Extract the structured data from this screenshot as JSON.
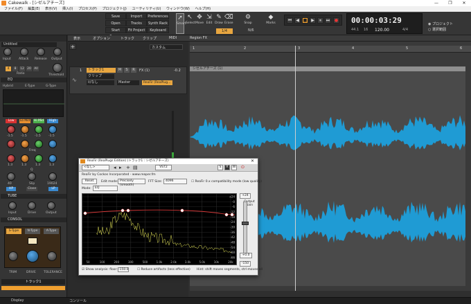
{
  "window": {
    "title": "Cakewalk - [シゼルアチーズ]",
    "controls": [
      "—",
      "❐",
      "✕"
    ]
  },
  "menu": [
    "ファイル(F)",
    "編集(E)",
    "表示(V)",
    "挿入(I)",
    "プロセス(P)",
    "プロジェクト(J)",
    "ユーティリティ(U)",
    "ウィンドウ(W)",
    "ヘルプ(H)"
  ],
  "control_bar": {
    "workspace_buttons": [
      [
        "Save",
        "Import",
        "Preferences"
      ],
      [
        "Open",
        "Tracks",
        "Synth Rack"
      ],
      [
        "Start Screen",
        "Fit Project",
        "Keyboard"
      ]
    ],
    "tools": [
      "Smart",
      "Select",
      "Move",
      "Edit",
      "Draw",
      "Erase"
    ],
    "snap": "Snap",
    "snap_value": "1/4",
    "nudge": "N/6",
    "marks": "Marks",
    "time": "00:00:03:29",
    "bpm": "120.00",
    "meter": "4/4",
    "sample_rate": "44.1",
    "bits": "16",
    "project_radio": "プロジェクト",
    "selection_radio": "選択範囲"
  },
  "inspector": {
    "track_label": "Untitled",
    "knob_labels": [
      "Input",
      "Attack",
      "Release",
      "Output"
    ],
    "ratio_values": [
      "4",
      "8",
      "12",
      "20",
      "All"
    ],
    "ratio_label": "Ratio",
    "threshold_label": "Threshold",
    "eq_label": "EQ",
    "eq_modes": [
      "Hybrid",
      "E-Type",
      "G-Type"
    ],
    "eq_bands": [
      "Low",
      "Lo Mid",
      "Hi Mid",
      "High"
    ],
    "gain_values": [
      "-1.5",
      "-1.5",
      "-1.5",
      "-1.5"
    ],
    "freq_label": "Freq",
    "q_label": "Q",
    "q_values": [
      "1.3",
      "1.3",
      "1.3",
      "1.3"
    ],
    "filter_labels": [
      "HP",
      "Slip",
      "LP"
    ],
    "hp_value": "40",
    "lp_value": "19024",
    "close_label": "Close",
    "tube_label": "TUBE",
    "tube_knobs": [
      "Input",
      "Drive",
      "Output"
    ],
    "console_label": "CONSOL",
    "console_modes": [
      "S-Type",
      "N-Type",
      "A-Type"
    ],
    "bottom_knobs": [
      "TRIM",
      "DRIVE",
      "TOLERANCE"
    ],
    "track_name": "トラック1",
    "display_tab": "Display"
  },
  "tabs": [
    "表示",
    "オプション",
    "トラック",
    "クリップ",
    "MIDI",
    "Region FX"
  ],
  "custom_select": "カスタム",
  "track": {
    "number": "1",
    "name": "トラック1",
    "clip_label": "クリップ",
    "input": "ii/なし",
    "output": "Master",
    "fx_label": "FX (1)",
    "fx_item": "ReaFir (ReaPlug...",
    "gain": "-0.2",
    "buttons": [
      "M",
      "S",
      "R"
    ]
  },
  "ruler": [
    "1",
    "2",
    "3",
    "4",
    "5",
    "6"
  ],
  "clip_name": "シゼルアチーズ (1)",
  "plugin": {
    "title": "ReaFir (ReaPlugs Edition) (トラック1 : シゼルアチーズ)",
    "preset": "<なし>",
    "plugin_format": "VST2",
    "header_buttons": [
      "S",
      "R",
      "W"
    ],
    "credit": "ReaFir by Cockos Incorporated - www.reaper.fm",
    "reset_button": "Reset",
    "edit_mode_label": "Edit mode:",
    "edit_mode_value": "Precisely (smooth)",
    "fft_label": "FFT Size:",
    "fft_value": "4096",
    "compat_label": "ReaFir 0.x compatibility mode (low quality)",
    "mode_label": "Mode:",
    "mode_value": "EQ",
    "output_gain_label": "Output Gain",
    "top_db": "+24",
    "output_gain_value": "+0.0",
    "floor_db": "-150",
    "db_ticks": [
      "+24",
      "-0",
      "-6",
      "-12",
      "-18",
      "-24",
      "-30",
      "-36",
      "-42",
      "-48",
      "-54",
      "-60",
      "-66"
    ],
    "freq_ticks": [
      "50",
      "100",
      "200",
      "300",
      "500",
      "1.0k",
      "2.0k",
      "3.0k",
      "5.0k",
      "10k",
      "20k"
    ],
    "show_analysis_label": "Show analysis: floor:",
    "analysis_floor": "-150.0",
    "artifacts_label": "Reduce artifacts (less effective)",
    "hint": "Hint: shift moves segments, ctrl moves all"
  },
  "status": [
    "Display",
    "コンソール"
  ],
  "colors": {
    "waveform": "#1f9bd4",
    "accent_orange": "#f0a030",
    "clip_bg": "#4a4a4a"
  }
}
